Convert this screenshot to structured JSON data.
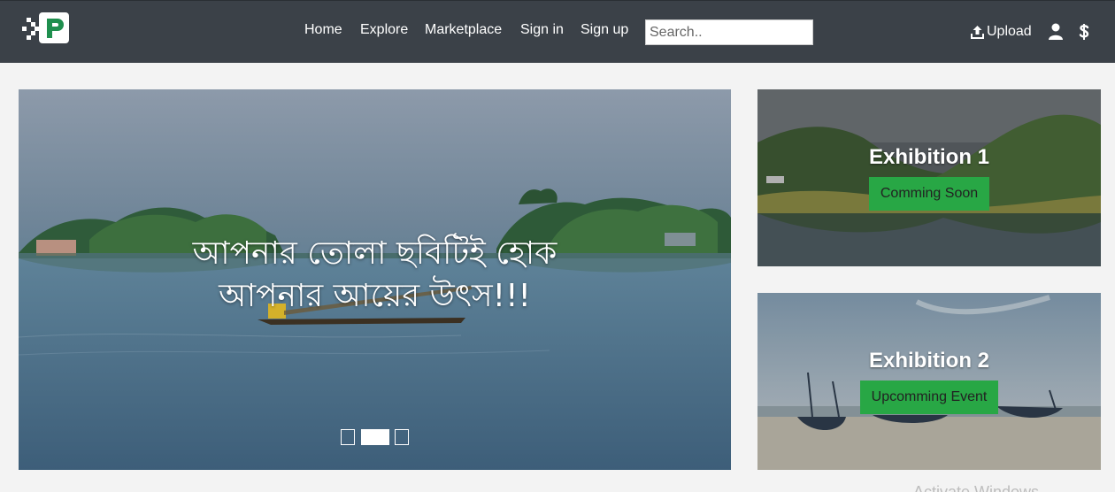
{
  "nav": {
    "links": [
      {
        "label": "Home"
      },
      {
        "label": "Explore"
      },
      {
        "label": "Marketplace"
      },
      {
        "label": "Sign in"
      },
      {
        "label": "Sign up"
      }
    ],
    "search": {
      "placeholder": "Search..",
      "value": ""
    },
    "upload_label": "Upload",
    "user_icon": "user-icon",
    "dollar_icon": "dollar-icon",
    "upload_icon": "upload-icon"
  },
  "hero": {
    "caption_line1": "আপনার তোলা ছবিটিই হোক",
    "caption_line2": "আপনার আয়ের উৎস!!!",
    "active_slide": 2,
    "slide_count": 3
  },
  "exhibitions": [
    {
      "title": "Exhibition 1",
      "button_label": "Comming Soon"
    },
    {
      "title": "Exhibition 2",
      "button_label": "Upcomming Event"
    }
  ],
  "watermark": "Activate Windows",
  "colors": {
    "navbar": "#3b4148",
    "accent_green": "#28a745",
    "page_bg": "#f3f3f3"
  }
}
